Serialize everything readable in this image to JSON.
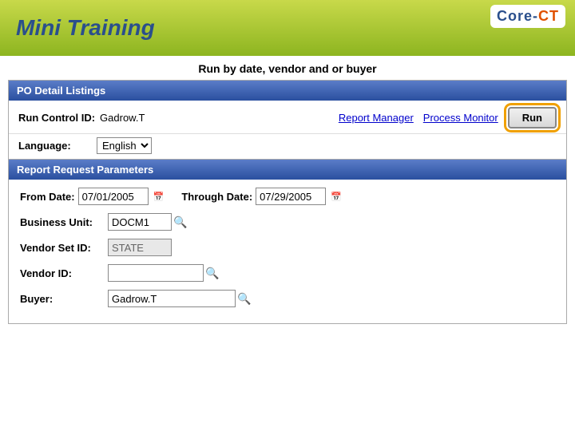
{
  "header": {
    "title": "Mini Training",
    "subtitle": "Run by date, vendor and or buyer",
    "logo": "Core-CT"
  },
  "panel": {
    "title": "PO Detail Listings"
  },
  "run_control": {
    "label": "Run Control ID:",
    "value": "Gadrow.T",
    "report_manager_link": "Report Manager",
    "process_monitor_link": "Process Monitor",
    "run_button": "Run"
  },
  "language": {
    "label": "Language:",
    "value": "English",
    "options": [
      "English"
    ]
  },
  "params_section": {
    "title": "Report Request Parameters",
    "from_date_label": "From Date:",
    "from_date_value": "07/01/2005",
    "through_date_label": "Through Date:",
    "through_date_value": "07/29/2005",
    "business_unit_label": "Business Unit:",
    "business_unit_value": "DOCM1",
    "vendor_set_id_label": "Vendor Set ID:",
    "vendor_set_id_value": "STATE",
    "vendor_id_label": "Vendor ID:",
    "vendor_id_value": "",
    "buyer_label": "Buyer:",
    "buyer_value": "Gadrow.T"
  }
}
